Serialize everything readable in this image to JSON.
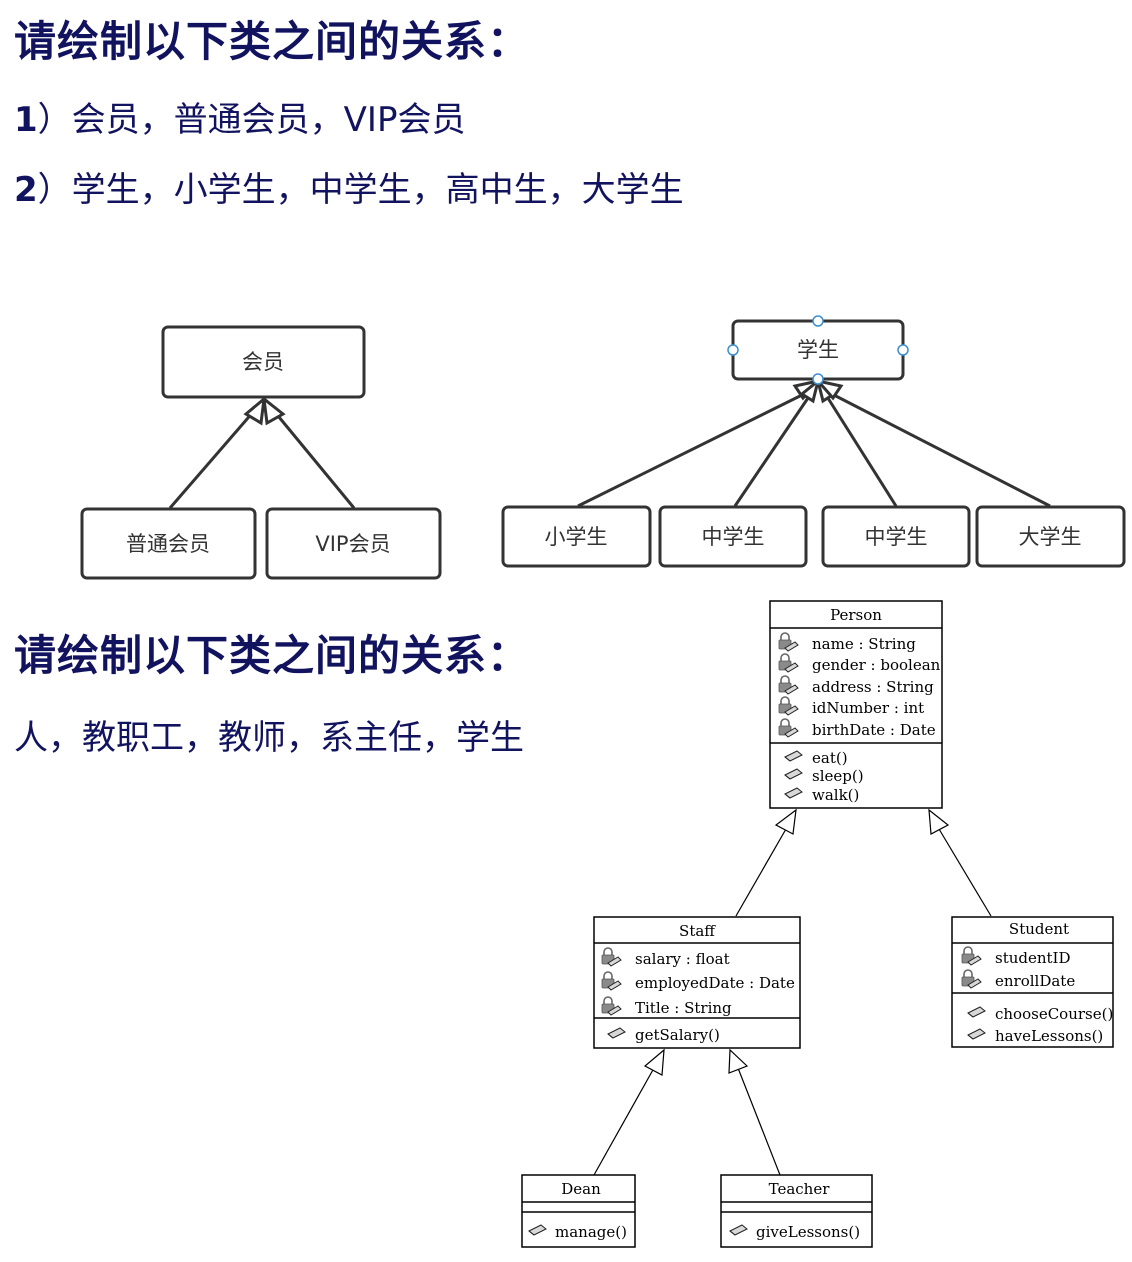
{
  "section1": {
    "heading": "请绘制以下类之间的关系：",
    "items": [
      {
        "num": "1",
        "text": "）会员，普通会员，VIP会员"
      },
      {
        "num": "2",
        "text": "）学生，小学生，中学生，高中生，大学生"
      }
    ]
  },
  "diagram1": {
    "parent": "会员",
    "children": [
      "普通会员",
      "VIP会员"
    ]
  },
  "diagram2": {
    "parent": "学生",
    "children": [
      "小学生",
      "中学生",
      "中学生",
      "大学生"
    ]
  },
  "section2": {
    "heading": "请绘制以下类之间的关系：",
    "text": "人，教职工，教师，系主任，学生"
  },
  "uml": {
    "person": {
      "name": "Person",
      "attributes": [
        "name : String",
        "gender : boolean",
        "address : String",
        "idNumber : int",
        "birthDate : Date"
      ],
      "operations": [
        "eat()",
        "sleep()",
        "walk()"
      ]
    },
    "staff": {
      "name": "Staff",
      "attributes": [
        "salary : float",
        "employedDate : Date",
        "Title : String"
      ],
      "operations": [
        "getSalary()"
      ]
    },
    "student": {
      "name": "Student",
      "attributes": [
        "studentID",
        "enrollDate"
      ],
      "operations": [
        "chooseCourse()",
        "haveLessons()"
      ]
    },
    "dean": {
      "name": "Dean",
      "attributes": [],
      "operations": [
        "manage()"
      ]
    },
    "teacher": {
      "name": "Teacher",
      "attributes": [],
      "operations": [
        "giveLessons()"
      ]
    }
  },
  "icons": {
    "attribute_icon": "lock-icon",
    "operation_icon": "pencil-icon"
  }
}
